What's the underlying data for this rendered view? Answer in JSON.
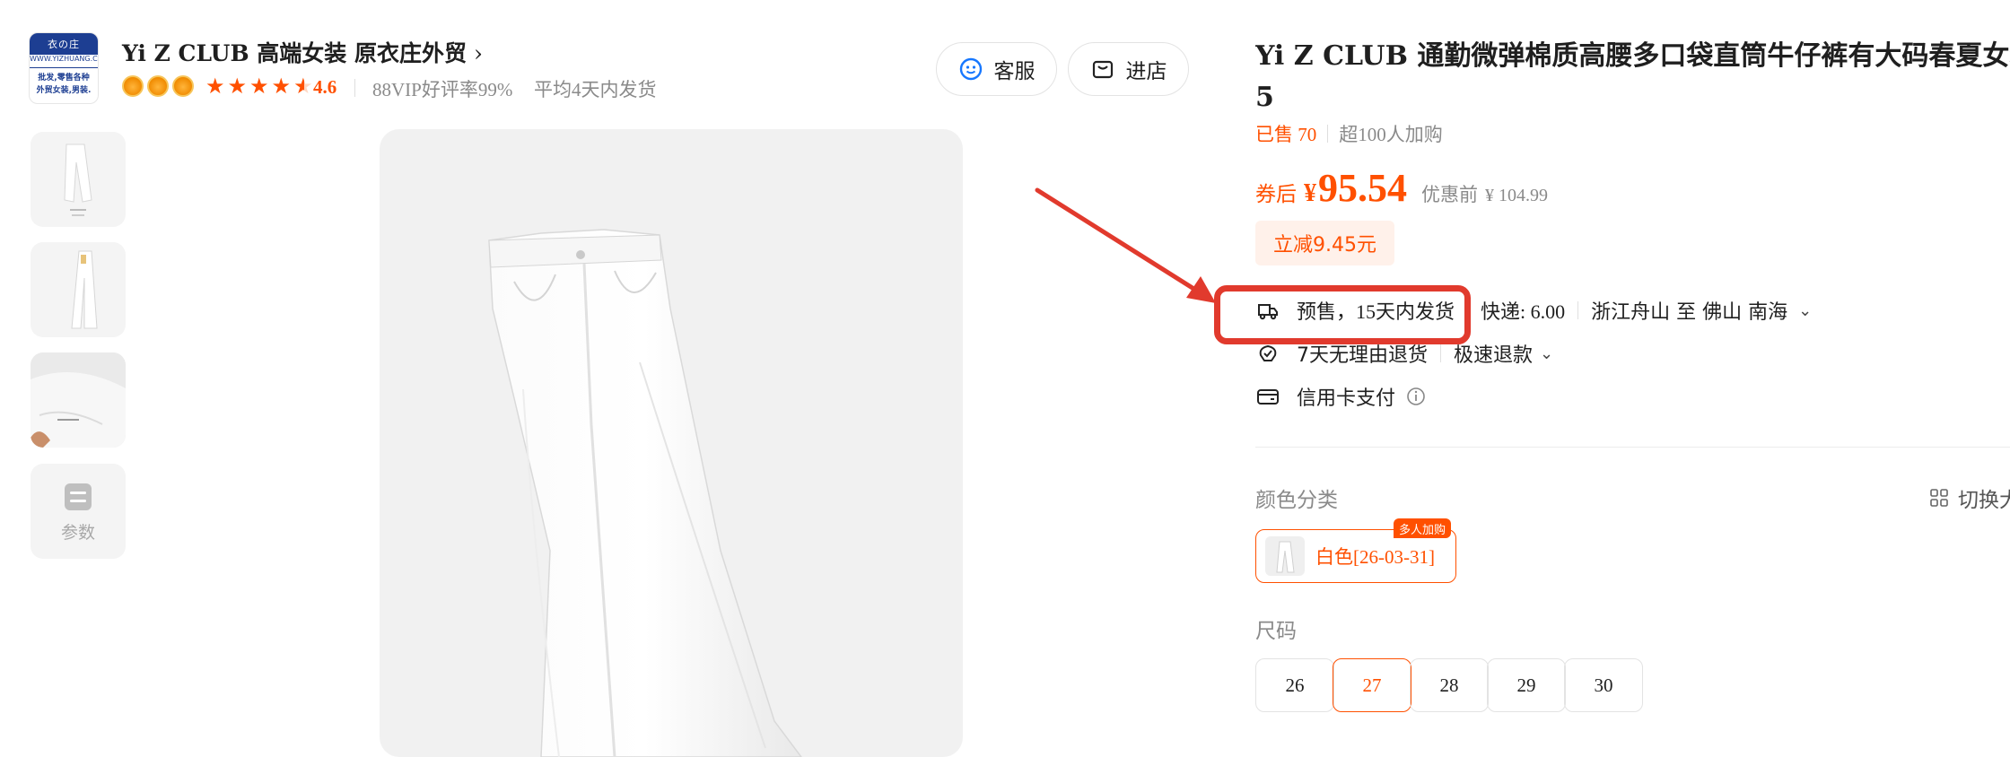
{
  "store": {
    "logo_band": "衣の庄",
    "logo_url": "WWW.YIZHUANG.COM",
    "logo_line1": "批发,零售各种",
    "logo_line2": "外贸女装,男装.",
    "name": "Yi Z CLUB 高端女装 原衣庄外贸",
    "chevron": "›",
    "crowns": 3,
    "rating": "4.6",
    "vip_rate": "88VIP好评率99%",
    "ship_avg": "平均4天内发货",
    "service_label": "客服",
    "shop_label": "进店"
  },
  "gallery": {
    "params_label": "参数"
  },
  "product": {
    "title_line1": "Yi Z CLUB 通勤微弹棉质高腰多口袋直筒牛仔裤有大码春夏女装",
    "title_line2": "5",
    "sold": "已售 70",
    "cart_count": "超100人加购",
    "price_prefix": "券后",
    "currency": "¥",
    "price": "95.54",
    "price_before_label": "优惠前",
    "price_before": "¥ 104.99",
    "discount_tag": "立减9.45元",
    "presale": "预售，15天内发货",
    "express": "快递: 6.00",
    "route": "浙江舟山 至 佛山 南海",
    "return_policy": "7天无理由退货",
    "refund": "极速退款",
    "payment": "信用卡支付",
    "color_label": "颜色分类",
    "switch_label": "切换大",
    "color_option": "白色[26-03-31]",
    "color_badge": "多人加购",
    "size_label": "尺码",
    "sizes": [
      "26",
      "27",
      "28",
      "29",
      "30"
    ],
    "selected_size": "27"
  },
  "colors": {
    "accent": "#ff5000",
    "annotation": "#e13a2d"
  }
}
